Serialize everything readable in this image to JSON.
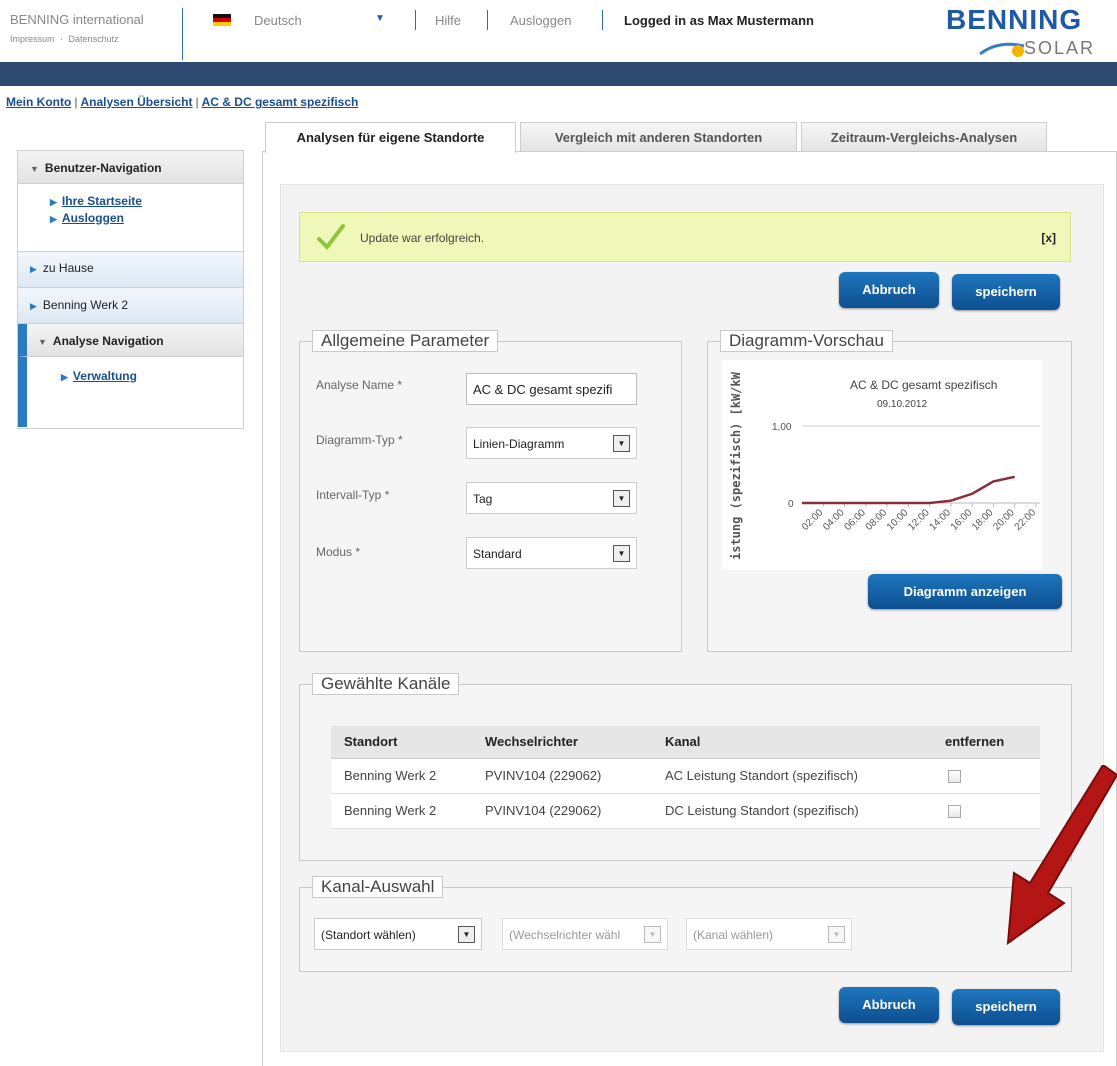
{
  "header": {
    "brand": "BENNING international",
    "brand_links": [
      "Impressum",
      "·",
      "Datenschutz"
    ],
    "language": "Deutsch",
    "help": "Hilfe",
    "logout": "Ausloggen",
    "logged_in": "Logged in as Max Mustermann",
    "logo_top": "BENNING",
    "logo_bottom": "SOLAR"
  },
  "breadcrumb": [
    {
      "label": "Mein Konto"
    },
    {
      "label": "Analysen Übersicht"
    },
    {
      "label": "AC & DC gesamt spezifisch"
    }
  ],
  "breadcrumb_sep": "|",
  "sidebar": {
    "user_nav_title": "Benutzer-Navigation",
    "user_links": [
      "Ihre Startseite",
      "Ausloggen"
    ],
    "home": "zu Hause",
    "werk": "Benning Werk 2",
    "analyse_nav_title": "Analyse Navigation",
    "analyse_link": "Verwaltung"
  },
  "tabs": [
    "Analysen für eigene Standorte",
    "Vergleich mit anderen Standorten",
    "Zeitraum-Vergleichs-Analysen"
  ],
  "success": {
    "message": "Update war erfolgreich.",
    "close": "[x]"
  },
  "buttons": {
    "cancel": "Abbruch",
    "save": "speichern",
    "show_chart": "Diagramm anzeigen"
  },
  "params": {
    "legend": "Allgemeine Parameter",
    "name_label": "Analyse Name *",
    "name_value": "AC & DC gesamt spezifi",
    "type_label": "Diagramm-Typ *",
    "type_value": "Linien-Diagramm",
    "interval_label": "Intervall-Typ *",
    "interval_value": "Tag",
    "mode_label": "Modus *",
    "mode_value": "Standard"
  },
  "preview": {
    "legend": "Diagramm-Vorschau",
    "title": "AC & DC gesamt spezifisch",
    "date": "09.10.2012",
    "ylabel": "istung (spezifisch) [kW/kW",
    "ytick_top": "1,00",
    "ytick_zero": "0"
  },
  "chart_data": {
    "type": "line",
    "title": "AC & DC gesamt spezifisch",
    "subtitle": "09.10.2012",
    "xlabel": "",
    "ylabel": "istung (spezifisch) [kW/kW",
    "categories": [
      "02:00",
      "04:00",
      "06:00",
      "08:00",
      "10:00",
      "12:00",
      "14:00",
      "16:00",
      "18:00",
      "20:00",
      "22:00"
    ],
    "x": [
      0,
      1,
      2,
      3,
      4,
      5,
      6,
      7,
      8,
      9,
      10,
      11
    ],
    "series": [
      {
        "values": [
          0,
          0,
          0,
          0,
          0,
          0,
          0,
          0.03,
          0.12,
          0.28,
          0.34,
          null
        ]
      }
    ],
    "ylim": [
      0,
      1.0
    ],
    "grid": true
  },
  "channels": {
    "legend": "Gewählte Kanäle",
    "headers": [
      "Standort",
      "Wechselrichter",
      "Kanal",
      "entfernen"
    ],
    "rows": [
      [
        "Benning Werk 2",
        "PVINV104 (229062)",
        "AC Leistung Standort (spezifisch)"
      ],
      [
        "Benning Werk 2",
        "PVINV104 (229062)",
        "DC Leistung Standort (spezifisch)"
      ]
    ]
  },
  "channel_select": {
    "legend": "Kanal-Auswahl",
    "standort": "(Standort wählen)",
    "wechselrichter": "(Wechselrichter wähl",
    "kanal": "(Kanal wählen)"
  },
  "colors": {
    "accent": "#2b7bc0",
    "topbar": "#2e4a72",
    "line": "#8b2b3b",
    "arrow": "#b41616"
  }
}
